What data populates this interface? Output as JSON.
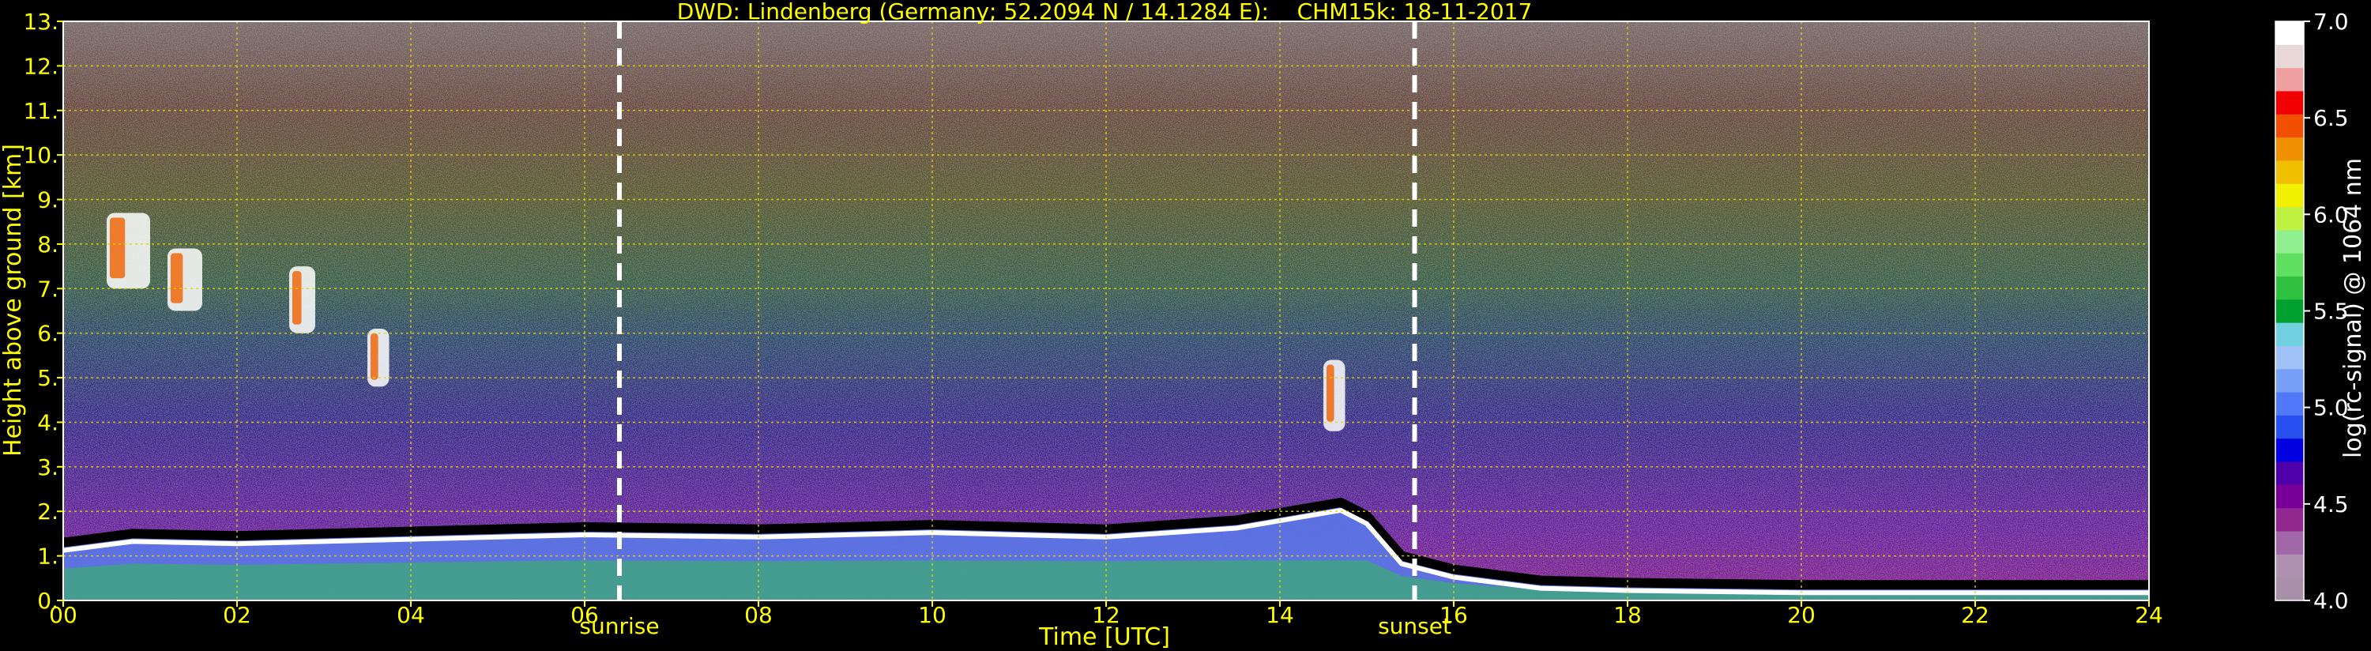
{
  "chart_data": {
    "type": "heatmap",
    "title": "DWD: Lindenberg (Germany; 52.2094 N / 14.1284 E):    CHM15k: 18-11-2017",
    "xlabel": "Time [UTC]",
    "ylabel": "Height above ground [km]",
    "xlim": [
      0,
      24
    ],
    "ylim": [
      0,
      13
    ],
    "x_ticks": [
      "00",
      "02",
      "04",
      "06",
      "08",
      "10",
      "12",
      "14",
      "16",
      "18",
      "20",
      "22",
      "24"
    ],
    "y_ticks": [
      "0.",
      "1.",
      "2.",
      "3.",
      "4.",
      "5.",
      "6.",
      "7.",
      "8.",
      "9.",
      "10.",
      "11.",
      "12.",
      "13."
    ],
    "grid": true,
    "colorbar": {
      "label": "log(rc-signal) @ 1064 nm",
      "range": [
        4.0,
        7.0
      ],
      "ticks": [
        "4.0",
        "4.5",
        "5.0",
        "5.5",
        "6.0",
        "6.5",
        "7.0"
      ],
      "colors": [
        "#a890a8",
        "#b090b0",
        "#a068a8",
        "#902890",
        "#780098",
        "#5000a8",
        "#0000e0",
        "#2850f0",
        "#5078f8",
        "#78a0f8",
        "#a0c0f8",
        "#70d0e0",
        "#00a030",
        "#30c040",
        "#60e060",
        "#90f090",
        "#c0f040",
        "#f0f000",
        "#f0c000",
        "#f09000",
        "#f05000",
        "#f00000",
        "#f0a0a0",
        "#e8d8d8",
        "#ffffff"
      ]
    },
    "annotations": [
      {
        "label": "sunrise",
        "x": 6.4
      },
      {
        "label": "sunset",
        "x": 15.55
      }
    ],
    "features": {
      "boundary_layer_top_km": [
        [
          0.0,
          1.3
        ],
        [
          0.8,
          1.5
        ],
        [
          2.0,
          1.45
        ],
        [
          4.0,
          1.55
        ],
        [
          6.0,
          1.65
        ],
        [
          8.0,
          1.6
        ],
        [
          10.0,
          1.7
        ],
        [
          12.0,
          1.6
        ],
        [
          13.5,
          1.8
        ],
        [
          14.7,
          2.2
        ],
        [
          15.0,
          1.9
        ],
        [
          15.4,
          1.0
        ],
        [
          16.0,
          0.7
        ],
        [
          17.0,
          0.45
        ],
        [
          18.0,
          0.4
        ],
        [
          20.0,
          0.35
        ],
        [
          22.0,
          0.35
        ],
        [
          24.0,
          0.35
        ]
      ],
      "clouds": [
        {
          "x": [
            2.6,
            2.9
          ],
          "y": [
            6.0,
            7.5
          ]
        },
        {
          "x": [
            3.5,
            3.75
          ],
          "y": [
            4.8,
            6.1
          ]
        },
        {
          "x": [
            14.5,
            14.75
          ],
          "y": [
            3.8,
            5.4
          ]
        },
        {
          "x": [
            0.5,
            1.0
          ],
          "y": [
            7.0,
            8.7
          ]
        },
        {
          "x": [
            1.2,
            1.6
          ],
          "y": [
            6.5,
            7.9
          ]
        }
      ]
    }
  }
}
